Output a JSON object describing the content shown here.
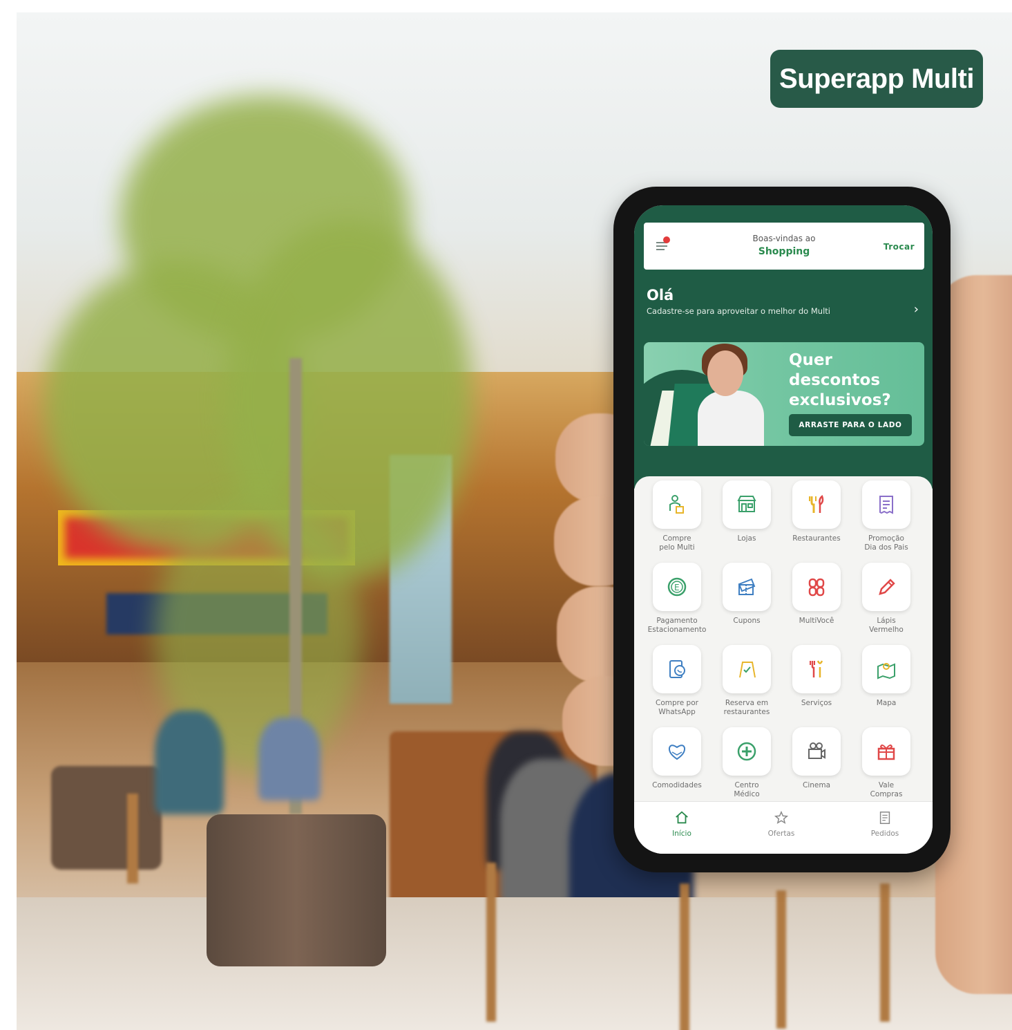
{
  "badge": {
    "label": "Superapp Multi"
  },
  "header": {
    "welcome": "Boas-vindas ao",
    "shopping": "Shopping",
    "switch_label": "Trocar"
  },
  "greeting": {
    "title": "Olá",
    "subtitle": "Cadastre-se para aproveitar o melhor do Multi"
  },
  "banner": {
    "headline": "Quer descontos exclusivos?",
    "button": "ARRASTE PARA O LADO"
  },
  "services": [
    {
      "label": "Compre\npelo Multi",
      "icon": "person-bag-icon"
    },
    {
      "label": "Lojas",
      "icon": "store-icon"
    },
    {
      "label": "Restaurantes",
      "icon": "fork-knife-icon"
    },
    {
      "label": "Promoção\nDia dos Pais",
      "icon": "receipt-icon"
    },
    {
      "label": "Pagamento\nEstacionamento",
      "icon": "parking-coin-icon"
    },
    {
      "label": "Cupons",
      "icon": "coupon-icon"
    },
    {
      "label": "MultiVocê",
      "icon": "multivoce-icon"
    },
    {
      "label": "Lápis\nVermelho",
      "icon": "pencil-icon"
    },
    {
      "label": "Compre por\nWhatsApp",
      "icon": "whatsapp-phone-icon"
    },
    {
      "label": "Reserva em\nrestaurantes",
      "icon": "reservation-icon"
    },
    {
      "label": "Serviços",
      "icon": "tools-icon"
    },
    {
      "label": "Mapa",
      "icon": "map-pin-icon"
    },
    {
      "label": "Comodidades",
      "icon": "heart-hands-icon"
    },
    {
      "label": "Centro\nMédico",
      "icon": "medical-cross-icon"
    },
    {
      "label": "Cinema",
      "icon": "camera-icon"
    },
    {
      "label": "Vale\nCompras",
      "icon": "gift-icon"
    }
  ],
  "tabs": [
    {
      "label": "Início",
      "icon": "home-icon",
      "active": true
    },
    {
      "label": "Ofertas",
      "icon": "star-icon",
      "active": false
    },
    {
      "label": "Pedidos",
      "icon": "orders-icon",
      "active": false
    }
  ],
  "colors": {
    "brand_green": "#1f5c45",
    "accent_green": "#2a8a4e",
    "icon_green": "#3aa06a",
    "icon_yellow": "#e8b52a",
    "icon_red": "#e04848",
    "icon_blue": "#3f7fc2"
  }
}
